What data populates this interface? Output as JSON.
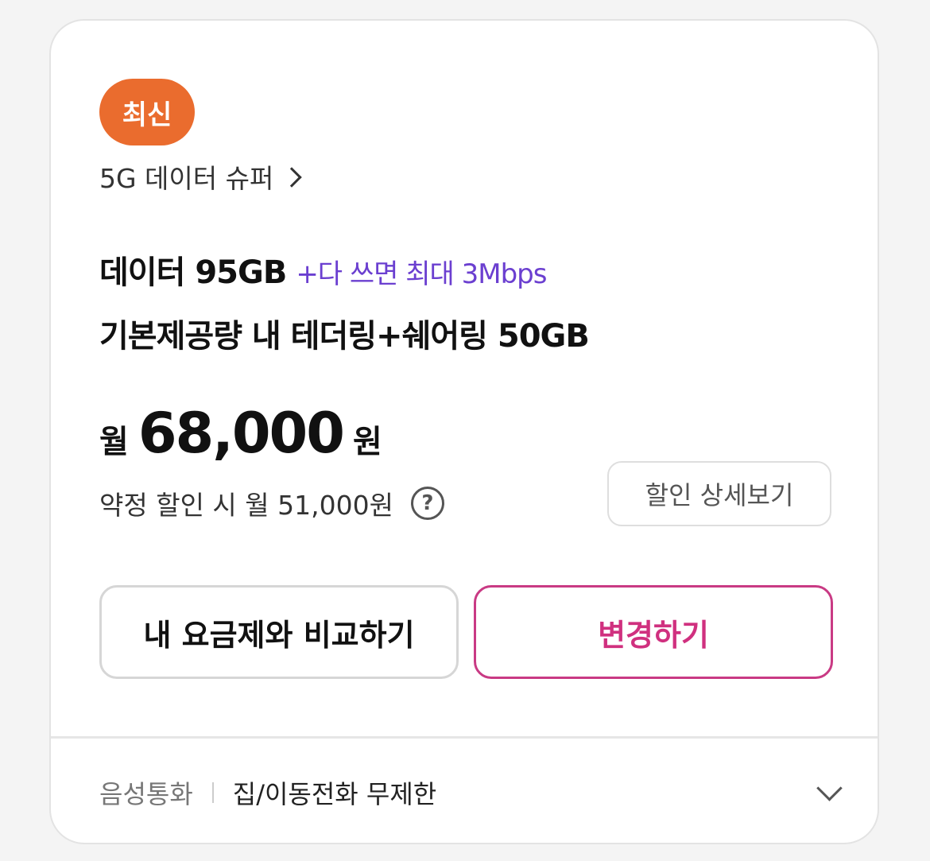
{
  "badge": {
    "label": "최신",
    "color": "#ea6c2e"
  },
  "plan": {
    "name": "5G 데이터 슈퍼",
    "link_icon": "chevron-right-icon"
  },
  "data": {
    "main": "데이터 95GB",
    "extra": "+다 쓰면 최대 3Mbps",
    "extra_color": "#6b3fd0"
  },
  "tethering": {
    "text": "기본제공량 내 테더링+쉐어링 50GB"
  },
  "price": {
    "prefix": "월",
    "amount": "68,000",
    "suffix": "원"
  },
  "discount": {
    "text": "약정 할인 시 월 51,000원",
    "help_icon": "question-circle-icon",
    "detail_button": "할인 상세보기"
  },
  "actions": {
    "compare_label": "내 요금제와 비교하기",
    "change_label": "변경하기",
    "change_color": "#d0307f"
  },
  "voice": {
    "label": "음성통화",
    "value": "집/이동전화 무제한",
    "expand_icon": "chevron-down-icon"
  }
}
